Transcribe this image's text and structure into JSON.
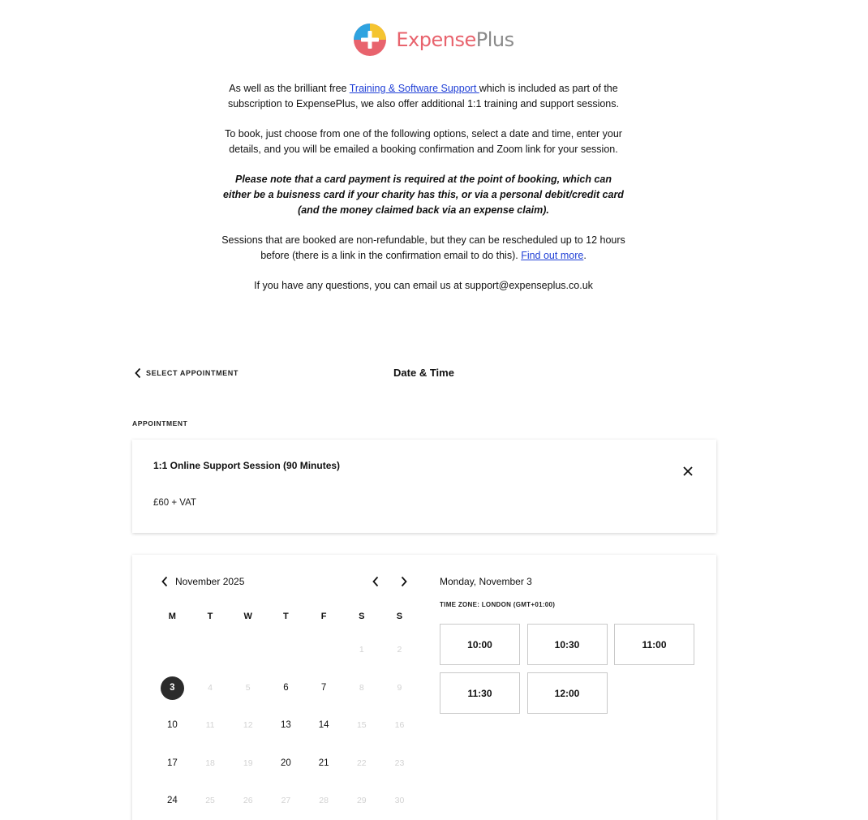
{
  "brand": {
    "name_part1": "Expense",
    "name_part2": "Plus",
    "colors": {
      "coral": "#e8636d",
      "grey": "#8a8a8a",
      "blue": "#2ea3e0",
      "yellow": "#f4c430"
    }
  },
  "intro": {
    "p1_before": "As well as the brilliant free ",
    "p1_link": "Training & Software Support ",
    "p1_after": "which is included as part of the subscription to ExpensePlus, we also offer additional 1:1 training and support sessions.",
    "p2": "To book, just choose from one of the following options, select a date and time, enter your details, and you will be emailed a booking confirmation and Zoom link for your session.",
    "p3": "Please note that a card payment is required at the point of booking, which can either be a buisness card if your charity has this, or via a personal debit/credit card (and the money claimed back via an expense claim).",
    "p4_before": "Sessions that are booked are non-refundable, but they can be rescheduled up to 12 hours before (there is a link in the confirmation email to do this). ",
    "p4_link": "Find out more",
    "p4_after": ".",
    "p5": "If you have any questions, you can email us at support@expenseplus.co.uk"
  },
  "scheduler": {
    "back_label": "SELECT APPOINTMENT",
    "title": "Date & Time",
    "appointment_label": "APPOINTMENT",
    "appointment": {
      "name": "1:1 Online Support Session (90 Minutes)",
      "price": "£60 + VAT"
    },
    "calendar": {
      "month": "November 2025",
      "weekdays": [
        "M",
        "T",
        "W",
        "T",
        "F",
        "S",
        "S"
      ],
      "weeks": [
        [
          {
            "d": ""
          },
          {
            "d": ""
          },
          {
            "d": ""
          },
          {
            "d": ""
          },
          {
            "d": ""
          },
          {
            "d": "1",
            "s": "disabled"
          },
          {
            "d": "2",
            "s": "disabled"
          }
        ],
        [
          {
            "d": "3",
            "s": "selected"
          },
          {
            "d": "4",
            "s": "disabled"
          },
          {
            "d": "5",
            "s": "disabled"
          },
          {
            "d": "6"
          },
          {
            "d": "7"
          },
          {
            "d": "8",
            "s": "disabled"
          },
          {
            "d": "9",
            "s": "disabled"
          }
        ],
        [
          {
            "d": "10"
          },
          {
            "d": "11",
            "s": "disabled"
          },
          {
            "d": "12",
            "s": "disabled"
          },
          {
            "d": "13"
          },
          {
            "d": "14"
          },
          {
            "d": "15",
            "s": "disabled"
          },
          {
            "d": "16",
            "s": "disabled"
          }
        ],
        [
          {
            "d": "17"
          },
          {
            "d": "18",
            "s": "disabled"
          },
          {
            "d": "19",
            "s": "disabled"
          },
          {
            "d": "20"
          },
          {
            "d": "21"
          },
          {
            "d": "22",
            "s": "disabled"
          },
          {
            "d": "23",
            "s": "disabled"
          }
        ],
        [
          {
            "d": "24"
          },
          {
            "d": "25",
            "s": "disabled"
          },
          {
            "d": "26",
            "s": "disabled"
          },
          {
            "d": "27",
            "s": "disabled"
          },
          {
            "d": "28",
            "s": "disabled"
          },
          {
            "d": "29",
            "s": "disabled"
          },
          {
            "d": "30",
            "s": "disabled"
          }
        ]
      ]
    },
    "selected_date": "Monday, November 3",
    "timezone": "TIME ZONE: LONDON (GMT+01:00)",
    "times": [
      "10:00",
      "10:30",
      "11:00",
      "11:30",
      "12:00"
    ]
  }
}
